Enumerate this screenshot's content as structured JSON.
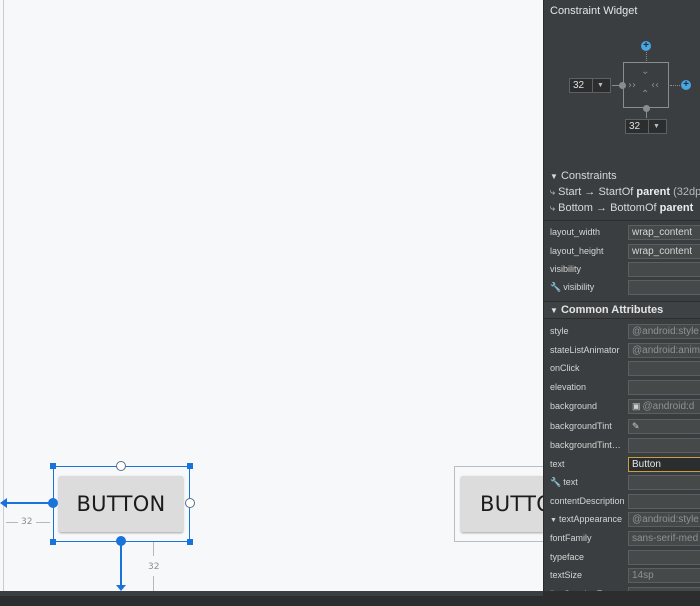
{
  "panel": {
    "title": "Constraint Widget",
    "margin_left": "32",
    "margin_bottom": "32",
    "constraints_header": "Constraints",
    "constraints": [
      {
        "from": "Start",
        "arrow": "→",
        "to": "StartOf",
        "target": "parent",
        "extra": "(32dp"
      },
      {
        "from": "Bottom",
        "arrow": "→",
        "to": "BottomOf",
        "target": "parent",
        "extra": ""
      }
    ],
    "layout_props": [
      {
        "label": "layout_width",
        "value": "wrap_content"
      },
      {
        "label": "layout_height",
        "value": "wrap_content"
      },
      {
        "label": "visibility",
        "value": ""
      },
      {
        "label": "visibility",
        "value": ""
      }
    ],
    "common_header": "Common Attributes",
    "common_props": [
      {
        "label": "style",
        "value": "@android:style"
      },
      {
        "label": "stateListAnimator",
        "value": "@android:anim"
      },
      {
        "label": "onClick",
        "value": ""
      },
      {
        "label": "elevation",
        "value": ""
      },
      {
        "label": "background",
        "value": "@android:d"
      },
      {
        "label": "backgroundTint",
        "value": ""
      },
      {
        "label": "backgroundTint…",
        "value": ""
      },
      {
        "label": "text",
        "value": "Button"
      },
      {
        "label": "text",
        "value": ""
      },
      {
        "label": "contentDescription",
        "value": ""
      },
      {
        "label": "textAppearance",
        "value": "@android:style"
      },
      {
        "label": "fontFamily",
        "value": "sans-serif-med"
      },
      {
        "label": "typeface",
        "value": ""
      },
      {
        "label": "textSize",
        "value": "14sp"
      },
      {
        "label": "lineSpacingExtra",
        "value": ""
      }
    ]
  },
  "canvas": {
    "button_label": "BUTTON",
    "preview_label": "BUTTO",
    "dim_left": "32",
    "dim_bottom": "32"
  },
  "colors": {
    "selection": "#1a73d9",
    "panel_bg": "#3b3e40",
    "plus": "#4aa5e0"
  }
}
